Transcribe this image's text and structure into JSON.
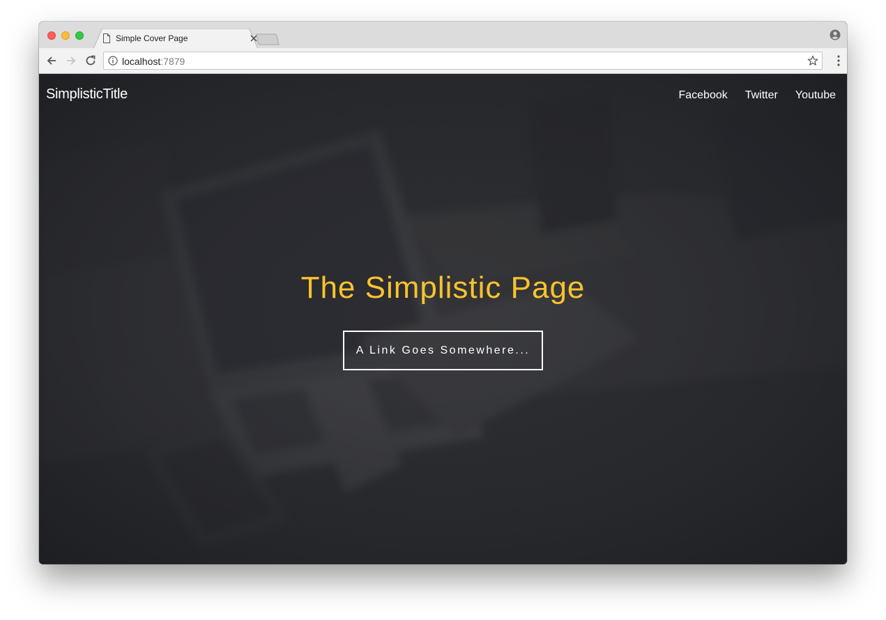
{
  "browser": {
    "tab": {
      "title": "Simple Cover Page"
    },
    "address_bar": {
      "host": "localhost",
      "port": ":7879"
    }
  },
  "site": {
    "brand": "SimplisticTitle",
    "nav": [
      {
        "label": "Facebook"
      },
      {
        "label": "Twitter"
      },
      {
        "label": "Youtube"
      }
    ],
    "hero": {
      "title": "The Simplistic Page",
      "cta_label": "A Link Goes Somewhere..."
    }
  },
  "colors": {
    "hero_title": "#f8c32d",
    "overlay": "#2a2b2f",
    "tabstrip": "#dcdcdc",
    "toolbar": "#f2f2f2"
  },
  "icons": [
    "document-icon",
    "close-icon",
    "new-tab-icon",
    "profile-icon",
    "back-icon",
    "forward-icon",
    "reload-icon",
    "info-icon",
    "star-icon",
    "menu-icon"
  ]
}
